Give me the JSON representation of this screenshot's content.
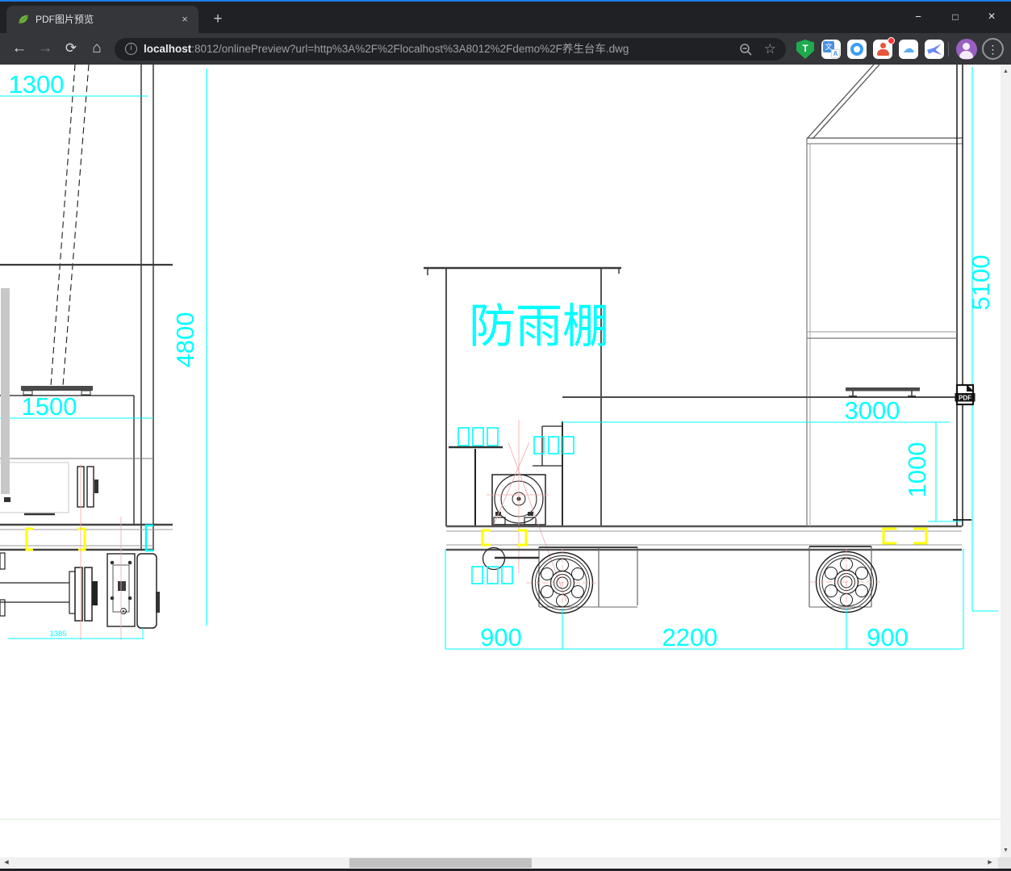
{
  "window": {
    "controls": {
      "minimize": "−",
      "maximize": "□",
      "close": "×"
    },
    "accent_color": "#1e7ce8"
  },
  "browser": {
    "tab": {
      "favicon": "spring-leaf-icon",
      "title": "PDF图片预览",
      "close": "×"
    },
    "new_tab_label": "+",
    "nav": {
      "back": "←",
      "forward": "→",
      "reload": "⟳",
      "home": "⌂"
    },
    "address": {
      "info_glyph": "i",
      "host": "localhost",
      "rest": ":8012/onlinePreview?url=http%3A%2F%2Flocalhost%3A8012%2Fdemo%2F养生台车.dwg",
      "bookmark_glyph": "☆"
    },
    "extensions": {
      "shield_letter": "T",
      "translate_glyph": "文",
      "translate_letter": "A"
    },
    "menu_glyph": "⋮"
  },
  "drawing": {
    "shelter_label": "防雨棚",
    "pdf_badge": "PDF",
    "dims": {
      "top_left_width": "1300",
      "left_height": "4800",
      "left_shelf_width": "1500",
      "left_track_width": "1385",
      "body_width": "3000",
      "body_height": "1000",
      "side_height": "5100",
      "front_left_offset": "900",
      "wheel_base": "2200",
      "rear_right_offset": "900"
    },
    "colors": {
      "dimension": "#00ffff",
      "highlight": "#ffff00",
      "centerline": "#f0a8a8",
      "line": "#1a1a1a"
    }
  },
  "scrollbar": {
    "up": "▲",
    "down": "▼",
    "left": "◀",
    "right": "▶"
  }
}
